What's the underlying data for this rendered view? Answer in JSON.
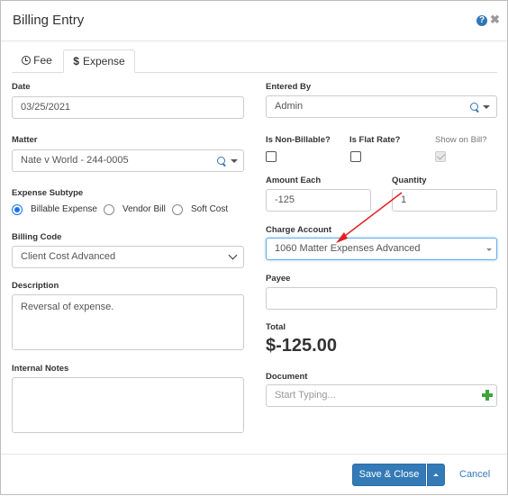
{
  "dialog": {
    "title": "Billing Entry",
    "help_icon": "question-circle-icon",
    "close_icon": "close-icon",
    "help_glyph": "?",
    "close_glyph": "✖"
  },
  "tabs": [
    {
      "label": "Fee",
      "icon": "clock-icon",
      "active": false
    },
    {
      "label": "Expense",
      "icon": "dollar-icon",
      "icon_glyph": "$",
      "active": true
    }
  ],
  "left": {
    "date": {
      "label": "Date",
      "value": "03/25/2021"
    },
    "matter": {
      "label": "Matter",
      "value": "Nate v World - 244-0005"
    },
    "expense_subtype": {
      "label": "Expense Subtype",
      "options": [
        {
          "label": "Billable Expense",
          "selected": true
        },
        {
          "label": "Vendor Bill",
          "selected": false
        },
        {
          "label": "Soft Cost",
          "selected": false
        }
      ]
    },
    "billing_code": {
      "label": "Billing Code",
      "value": "Client Cost Advanced"
    },
    "description": {
      "label": "Description",
      "value": "Reversal of expense."
    },
    "internal_notes": {
      "label": "Internal Notes",
      "value": ""
    }
  },
  "right": {
    "entered_by": {
      "label": "Entered By",
      "value": "Admin"
    },
    "non_billable": {
      "label": "Is Non-Billable?",
      "checked": false
    },
    "flat_rate": {
      "label": "Is Flat Rate?",
      "checked": false
    },
    "show_on_bill": {
      "label": "Show on Bill?",
      "checked": true,
      "disabled": true
    },
    "amount_each": {
      "label": "Amount Each",
      "value": "-125"
    },
    "quantity": {
      "label": "Quantity",
      "value": "1"
    },
    "charge_account": {
      "label": "Charge Account",
      "value": "1060 Matter Expenses Advanced"
    },
    "payee": {
      "label": "Payee",
      "value": ""
    },
    "total": {
      "label": "Total",
      "value": "$-125.00"
    },
    "document": {
      "label": "Document",
      "placeholder": "Start Typing..."
    }
  },
  "footer": {
    "save_label": "Save & Close",
    "cancel_label": "Cancel"
  },
  "colors": {
    "primary": "#337ab7",
    "annotation_arrow": "#e02020",
    "add_icon": "#3ca63c"
  }
}
